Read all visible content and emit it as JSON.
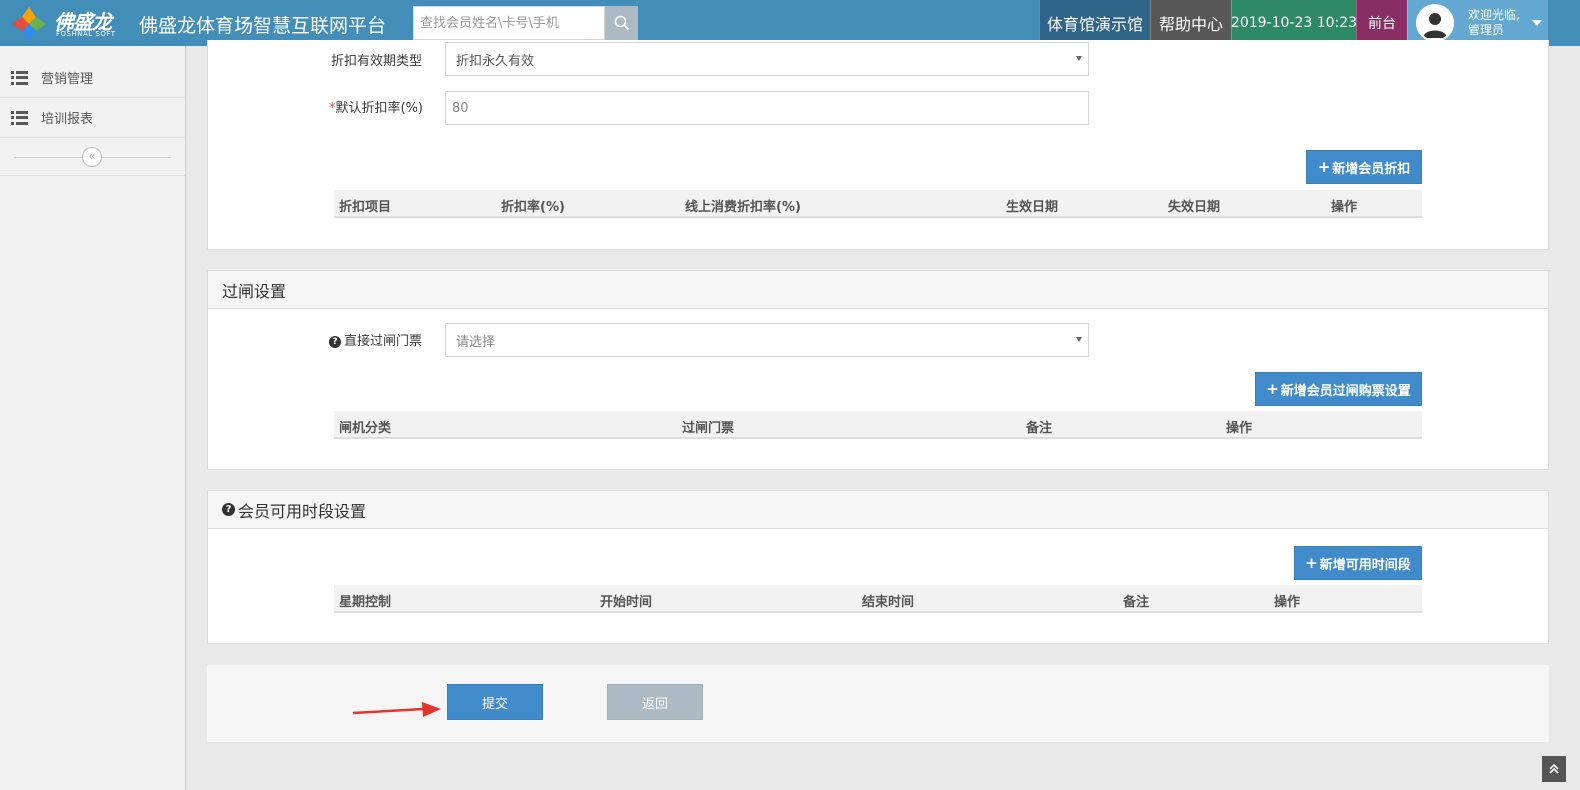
{
  "header": {
    "logo_text": "佛盛龙",
    "logo_sub": "FOSHNAL SOFT",
    "app_title": "佛盛龙体育场智慧互联网平台",
    "search_placeholder": "查找会员姓名\\卡号\\手机",
    "venue": "体育馆演示馆",
    "help": "帮助中心",
    "datetime": "2019-10-23 10:23",
    "front_desk": "前台",
    "welcome": "欢迎光临,",
    "user_role": "管理员"
  },
  "sidebar": {
    "items": [
      {
        "label": "营销管理",
        "icon": "list-icon"
      },
      {
        "label": "培训报表",
        "icon": "list-icon"
      }
    ],
    "collapse_symbol": "«"
  },
  "discount": {
    "period_type_label": "折扣有效期类型",
    "period_type_value": "折扣永久有效",
    "rate_required": "*",
    "rate_label": "默认折扣率(%)",
    "rate_value": "80",
    "add_button": "新增会员折扣",
    "columns": [
      "折扣项目",
      "折扣率(%)",
      "线上消费折扣率(%)",
      "生效日期",
      "失效日期",
      "操作"
    ]
  },
  "gate": {
    "title": "过闸设置",
    "ticket_label": "直接过闸门票",
    "ticket_placeholder": "请选择",
    "add_button": "新增会员过闸购票设置",
    "columns": [
      "闸机分类",
      "过闸门票",
      "备注",
      "操作"
    ]
  },
  "time_slot": {
    "title": "会员可用时段设置",
    "add_button": "新增可用时间段",
    "columns": [
      "星期控制",
      "开始时间",
      "结束时间",
      "备注",
      "操作"
    ]
  },
  "actions": {
    "submit": "提交",
    "back": "返回"
  },
  "colors": {
    "header_bg": "#438eb9",
    "venue_bg": "#2e6589",
    "help_bg": "#585858",
    "time_bg": "#2e8965",
    "front_bg": "#892e65",
    "user_bg": "#62a8d1",
    "primary_button": "#428bca",
    "secondary_button": "#abbac3",
    "annotation_arrow": "#e8322e"
  }
}
